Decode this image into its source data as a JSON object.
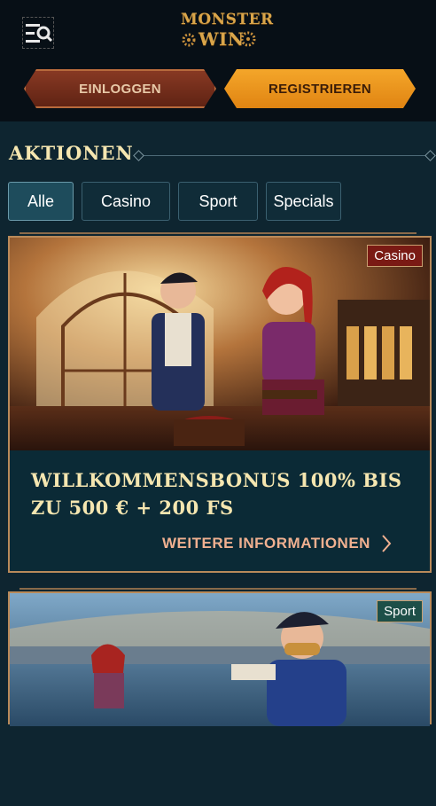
{
  "header": {
    "logo_line1": "MONSTER",
    "logo_line2": "WIN",
    "login_label": "EINLOGGEN",
    "register_label": "REGISTRIEREN"
  },
  "section": {
    "title": "AKTIONEN"
  },
  "tabs": [
    {
      "label": "Alle",
      "active": true
    },
    {
      "label": "Casino",
      "active": false
    },
    {
      "label": "Sport",
      "active": false
    },
    {
      "label": "Specials",
      "active": false
    }
  ],
  "promos": [
    {
      "badge": "Casino",
      "title": "WILLKOMMENSBONUS 100% BIS ZU 500 € + 200 FS",
      "link": "WEITERE INFORMATIONEN"
    },
    {
      "badge": "Sport"
    }
  ],
  "colors": {
    "background": "#0e2530",
    "header": "#070f16",
    "accent_orange": "#f4a62a",
    "login_red": "#8a3a24",
    "title_cream": "#f5e6b0",
    "link_salmon": "#f0b090"
  },
  "icons": [
    "menu-search-icon",
    "chevron-right-icon"
  ]
}
